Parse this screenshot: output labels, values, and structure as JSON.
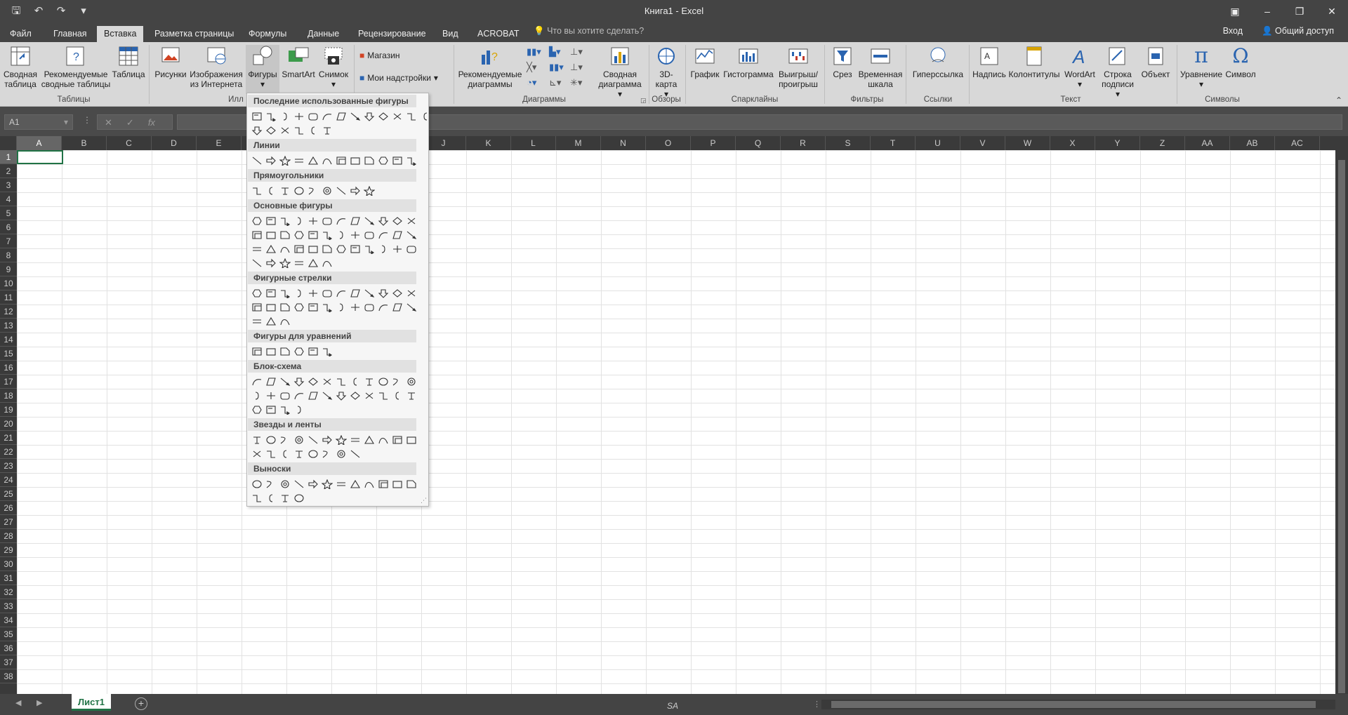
{
  "window": {
    "title": "Книга1 - Excel",
    "qat": [
      "save-icon",
      "undo-icon",
      "redo-icon",
      "customize-qat-icon"
    ],
    "controls": [
      "ribbon-display-icon",
      "minimize-icon",
      "restore-icon",
      "close-icon"
    ]
  },
  "tabs": [
    "Файл",
    "Главная",
    "Вставка",
    "Разметка страницы",
    "Формулы",
    "Данные",
    "Рецензирование",
    "Вид",
    "ACROBAT"
  ],
  "active_tab": "Вставка",
  "tellme": "Что вы хотите сделать?",
  "signin": "Вход",
  "share": "Общий доступ",
  "ribbon": {
    "pivot": "Сводная таблица",
    "recpivot": "Рекомендуемые сводные таблицы",
    "table": "Таблица",
    "pictures": "Рисунки",
    "online": "Изображения из Интернета",
    "shapes": "Фигуры",
    "smartart": "SmartArt",
    "screenshot": "Снимок",
    "store": "Магазин",
    "addins": "Мои надстройки",
    "recchart": "Рекомендуемые диаграммы",
    "pivotchart": "Сводная диаграмма",
    "map3d": "3D-карта",
    "line": "График",
    "column": "Гистограмма",
    "winloss": "Выигрыш/проигрыш",
    "slicer": "Срез",
    "timeline": "Временная шкала",
    "hyperlink": "Гиперссылка",
    "textbox": "Надпись",
    "headerfooter": "Колонтитулы",
    "wordart": "WordArt",
    "signature": "Строка подписи",
    "object": "Объект",
    "equation": "Уравнение",
    "symbol": "Символ",
    "groups": {
      "tables": "Таблицы",
      "illustr": "Илл",
      "charts": "Диаграммы",
      "tours": "Обзоры",
      "sparklines": "Спарклайны",
      "filters": "Фильтры",
      "links": "Ссылки",
      "text": "Текст",
      "symbols": "Символы"
    }
  },
  "namebox": "A1",
  "columns": [
    "A",
    "B",
    "C",
    "D",
    "E",
    "F",
    "G",
    "H",
    "I",
    "J",
    "K",
    "L",
    "M",
    "N",
    "O",
    "P",
    "Q",
    "R",
    "S",
    "T",
    "U",
    "V",
    "W",
    "X",
    "Y",
    "Z",
    "AA",
    "AB",
    "AC"
  ],
  "rows": [
    "1",
    "2",
    "3",
    "4",
    "5",
    "6",
    "7",
    "8",
    "9",
    "10",
    "11",
    "12",
    "13",
    "14",
    "15",
    "16",
    "17",
    "18",
    "19",
    "20",
    "21",
    "22",
    "23",
    "24",
    "25",
    "26",
    "27",
    "28",
    "29",
    "30",
    "31",
    "32",
    "33",
    "34",
    "35",
    "36",
    "37",
    "38"
  ],
  "sheet_tab": "Лист1",
  "watermark": "SA",
  "gallery": {
    "sections": [
      {
        "title": "Последние использованные фигуры",
        "rows": [
          13,
          6
        ]
      },
      {
        "title": "Линии",
        "rows": [
          12
        ]
      },
      {
        "title": "Прямоугольники",
        "rows": [
          9
        ]
      },
      {
        "title": "Основные фигуры",
        "rows": [
          12,
          12,
          12,
          6
        ]
      },
      {
        "title": "Фигурные стрелки",
        "rows": [
          12,
          12,
          3
        ]
      },
      {
        "title": "Фигуры для уравнений",
        "rows": [
          6
        ]
      },
      {
        "title": "Блок-схема",
        "rows": [
          12,
          12,
          4
        ]
      },
      {
        "title": "Звезды и ленты",
        "rows": [
          12,
          8
        ]
      },
      {
        "title": "Выноски",
        "rows": [
          12,
          4
        ]
      }
    ]
  }
}
